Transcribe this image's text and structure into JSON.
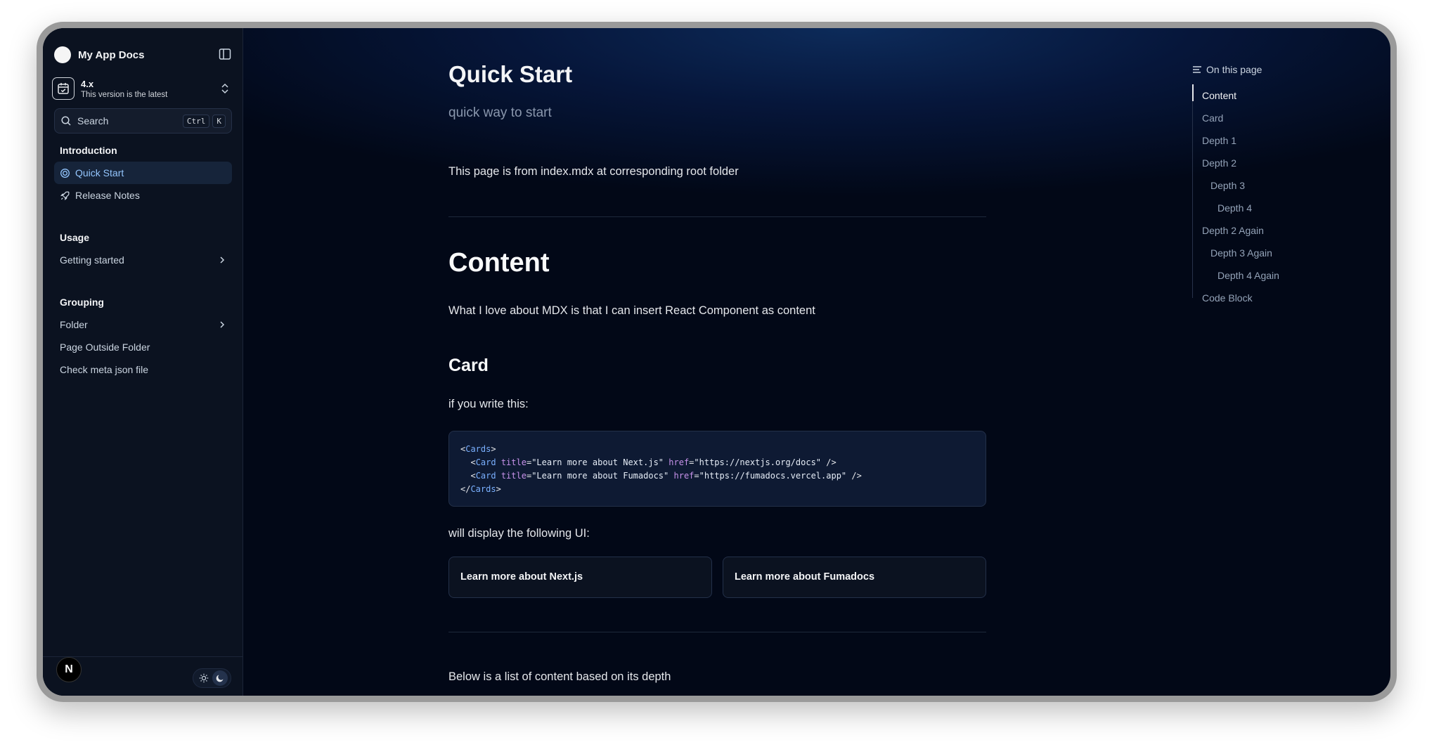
{
  "sidebar": {
    "app_title": "My App Docs",
    "version": {
      "name": "4.x",
      "subtitle": "This version is the latest"
    },
    "search": {
      "label": "Search",
      "kbd_ctrl": "Ctrl",
      "kbd_key": "K"
    },
    "sections": [
      {
        "title": "Introduction",
        "items": [
          {
            "label": "Quick Start",
            "icon": "target-icon",
            "active": true
          },
          {
            "label": "Release Notes",
            "icon": "rocket-icon"
          }
        ]
      },
      {
        "title": "Usage",
        "items": [
          {
            "label": "Getting started",
            "expandable": true
          }
        ]
      },
      {
        "title": "Grouping",
        "items": [
          {
            "label": "Folder",
            "expandable": true
          },
          {
            "label": "Page Outside Folder"
          },
          {
            "label": "Check meta json file"
          }
        ]
      }
    ],
    "footer": {
      "badge": "N"
    }
  },
  "main": {
    "title": "Quick Start",
    "description": "quick way to start",
    "intro": "This page is from index.mdx at corresponding root folder",
    "content_heading": "Content",
    "content_text": "What I love about MDX is that I can insert React Component as content",
    "card_heading": "Card",
    "card_text": "if you write this:",
    "code": {
      "line1_tag": "Cards",
      "line2_tag": "Card",
      "line2_attr1": "title",
      "line2_val1": "\"Learn more about Next.js\"",
      "line2_attr2": "href",
      "line2_val2": "\"https://nextjs.org/docs\"",
      "line3_tag": "Card",
      "line3_attr1": "title",
      "line3_val1": "\"Learn more about Fumadocs\"",
      "line3_attr2": "href",
      "line3_val2": "\"https://fumadocs.vercel.app\"",
      "line4_tag": "Cards"
    },
    "display_text": "will display the following UI:",
    "cards": [
      "Learn more about Next.js",
      "Learn more about Fumadocs"
    ],
    "depth_text": "Below is a list of content based on its depth"
  },
  "toc": {
    "heading": "On this page",
    "items": [
      {
        "label": "Content",
        "depth": 1,
        "active": true
      },
      {
        "label": "Card",
        "depth": 1
      },
      {
        "label": "Depth 1",
        "depth": 1
      },
      {
        "label": "Depth 2",
        "depth": 1
      },
      {
        "label": "Depth 3",
        "depth": 2
      },
      {
        "label": "Depth 4",
        "depth": 3
      },
      {
        "label": "Depth 2 Again",
        "depth": 1
      },
      {
        "label": "Depth 3 Again",
        "depth": 2
      },
      {
        "label": "Depth 4 Again",
        "depth": 3
      },
      {
        "label": "Code Block",
        "depth": 1
      }
    ]
  },
  "colors": {
    "background": "#020817",
    "accent": "#93c5fd",
    "sidebar": "#0b1220"
  }
}
